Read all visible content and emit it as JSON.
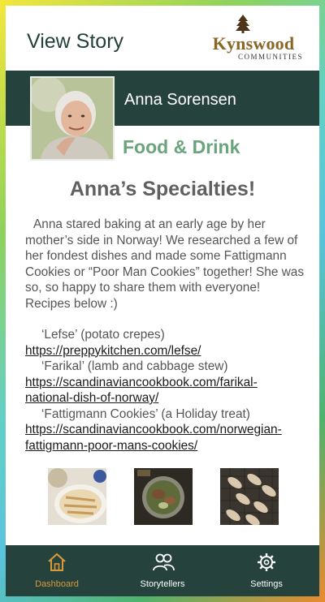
{
  "header": {
    "title": "View Story",
    "logo_name": "Kynswood",
    "logo_sub": "COMMUNITIES"
  },
  "profile": {
    "name": "Anna Sorensen",
    "category": "Food & Drink"
  },
  "story": {
    "title": "Anna’s Specialties!",
    "intro": "Anna stared baking at an early age by her mother’s side in Norway! We researched a few of her fondest dishes and made some Fattigmann Cookies or “Poor Man Cookies” together! She was so, so happy to share them with everyone! Recipes below :)",
    "recipes": [
      {
        "name": "‘Lefse’ (potato crepes)",
        "link": "https://preppykitchen.com/lefse/"
      },
      {
        "name": "‘Farikal’ (lamb and cabbage stew)",
        "link": "https://scandinaviancookbook.com/farikal-national-dish-of-norway/"
      },
      {
        "name": "‘Fattigmann Cookies’ (a Holiday treat)",
        "link": "https://scandinaviancookbook.com/norwegian-fattigmann-poor-mans-cookies/"
      }
    ]
  },
  "tabs": {
    "dashboard": "Dashboard",
    "storytellers": "Storytellers",
    "settings": "Settings"
  },
  "colors": {
    "band": "#26423c",
    "accent_green": "#6aa47c",
    "active_tab": "#d99a3a"
  }
}
